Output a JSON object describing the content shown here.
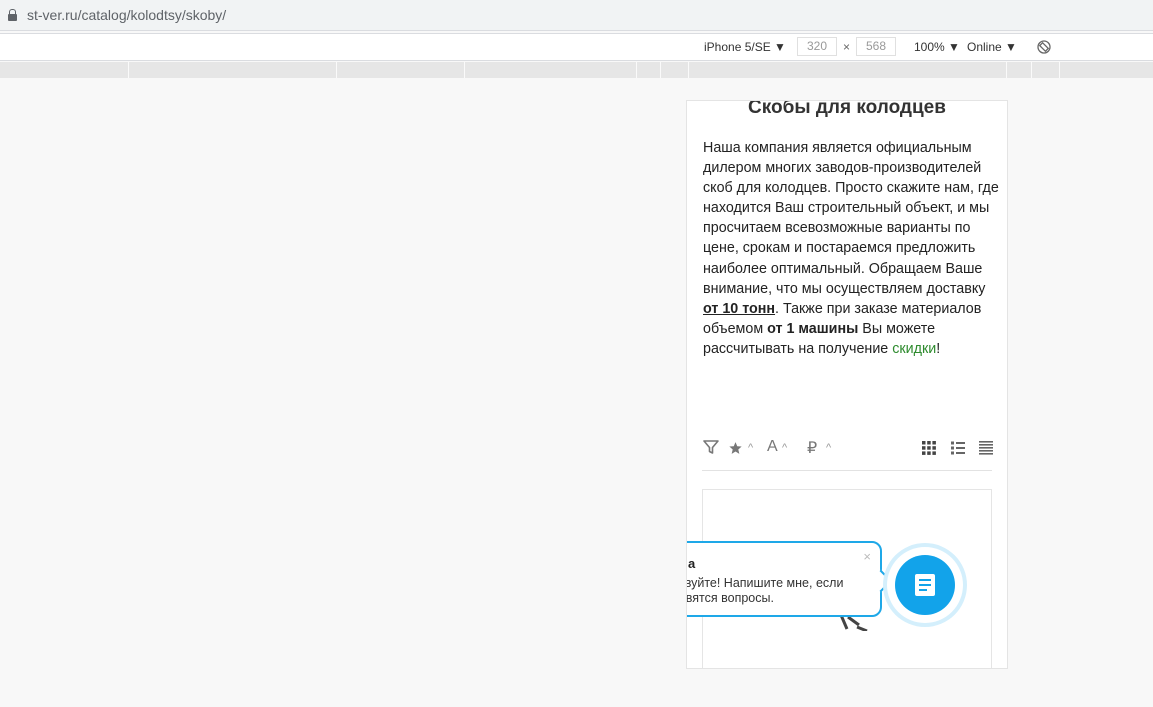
{
  "browser": {
    "url": "st-ver.ru/catalog/kolodtsy/skoby/"
  },
  "device_toolbar": {
    "device": "iPhone 5/SE ▼",
    "width": "320",
    "times": "×",
    "height": "568",
    "zoom": "100% ▼",
    "network": "Online ▼",
    "icons": [
      "lock-icon",
      "rotate-icon"
    ]
  },
  "page": {
    "title": "Скобы для колодцев",
    "desc_part1": "Наша компания является официальным дилером многих заводов-производителей скоб для колодцев. Просто скажите нам, где находится Ваш строительный объект, и мы просчитаем всевозможные варианты по цене, срокам и постараемся предложить наиболее оптимальный. Обращаем Ваше внимание, что мы осуществляем доставку ",
    "desc_delivery": "от 10 тонн",
    "desc_part2": ". Также при заказе материалов объемом ",
    "desc_volume": "от 1 машины",
    "desc_part3": " Вы можете рассчитывать на получение ",
    "desc_discount": "скидки",
    "desc_end": "!",
    "sort_icons": [
      "filter-icon",
      "star-icon",
      "font-icon",
      "ruble-icon",
      "grid-view-icon",
      "list-view-icon",
      "table-view-icon"
    ],
    "sort": {
      "a_glyph": "A",
      "ruble_glyph": "₽"
    }
  },
  "chat": {
    "sender": "a",
    "message_line1": "твуйте! Напишите мне, если",
    "message_line2": "явятся вопросы.",
    "close": "×"
  }
}
